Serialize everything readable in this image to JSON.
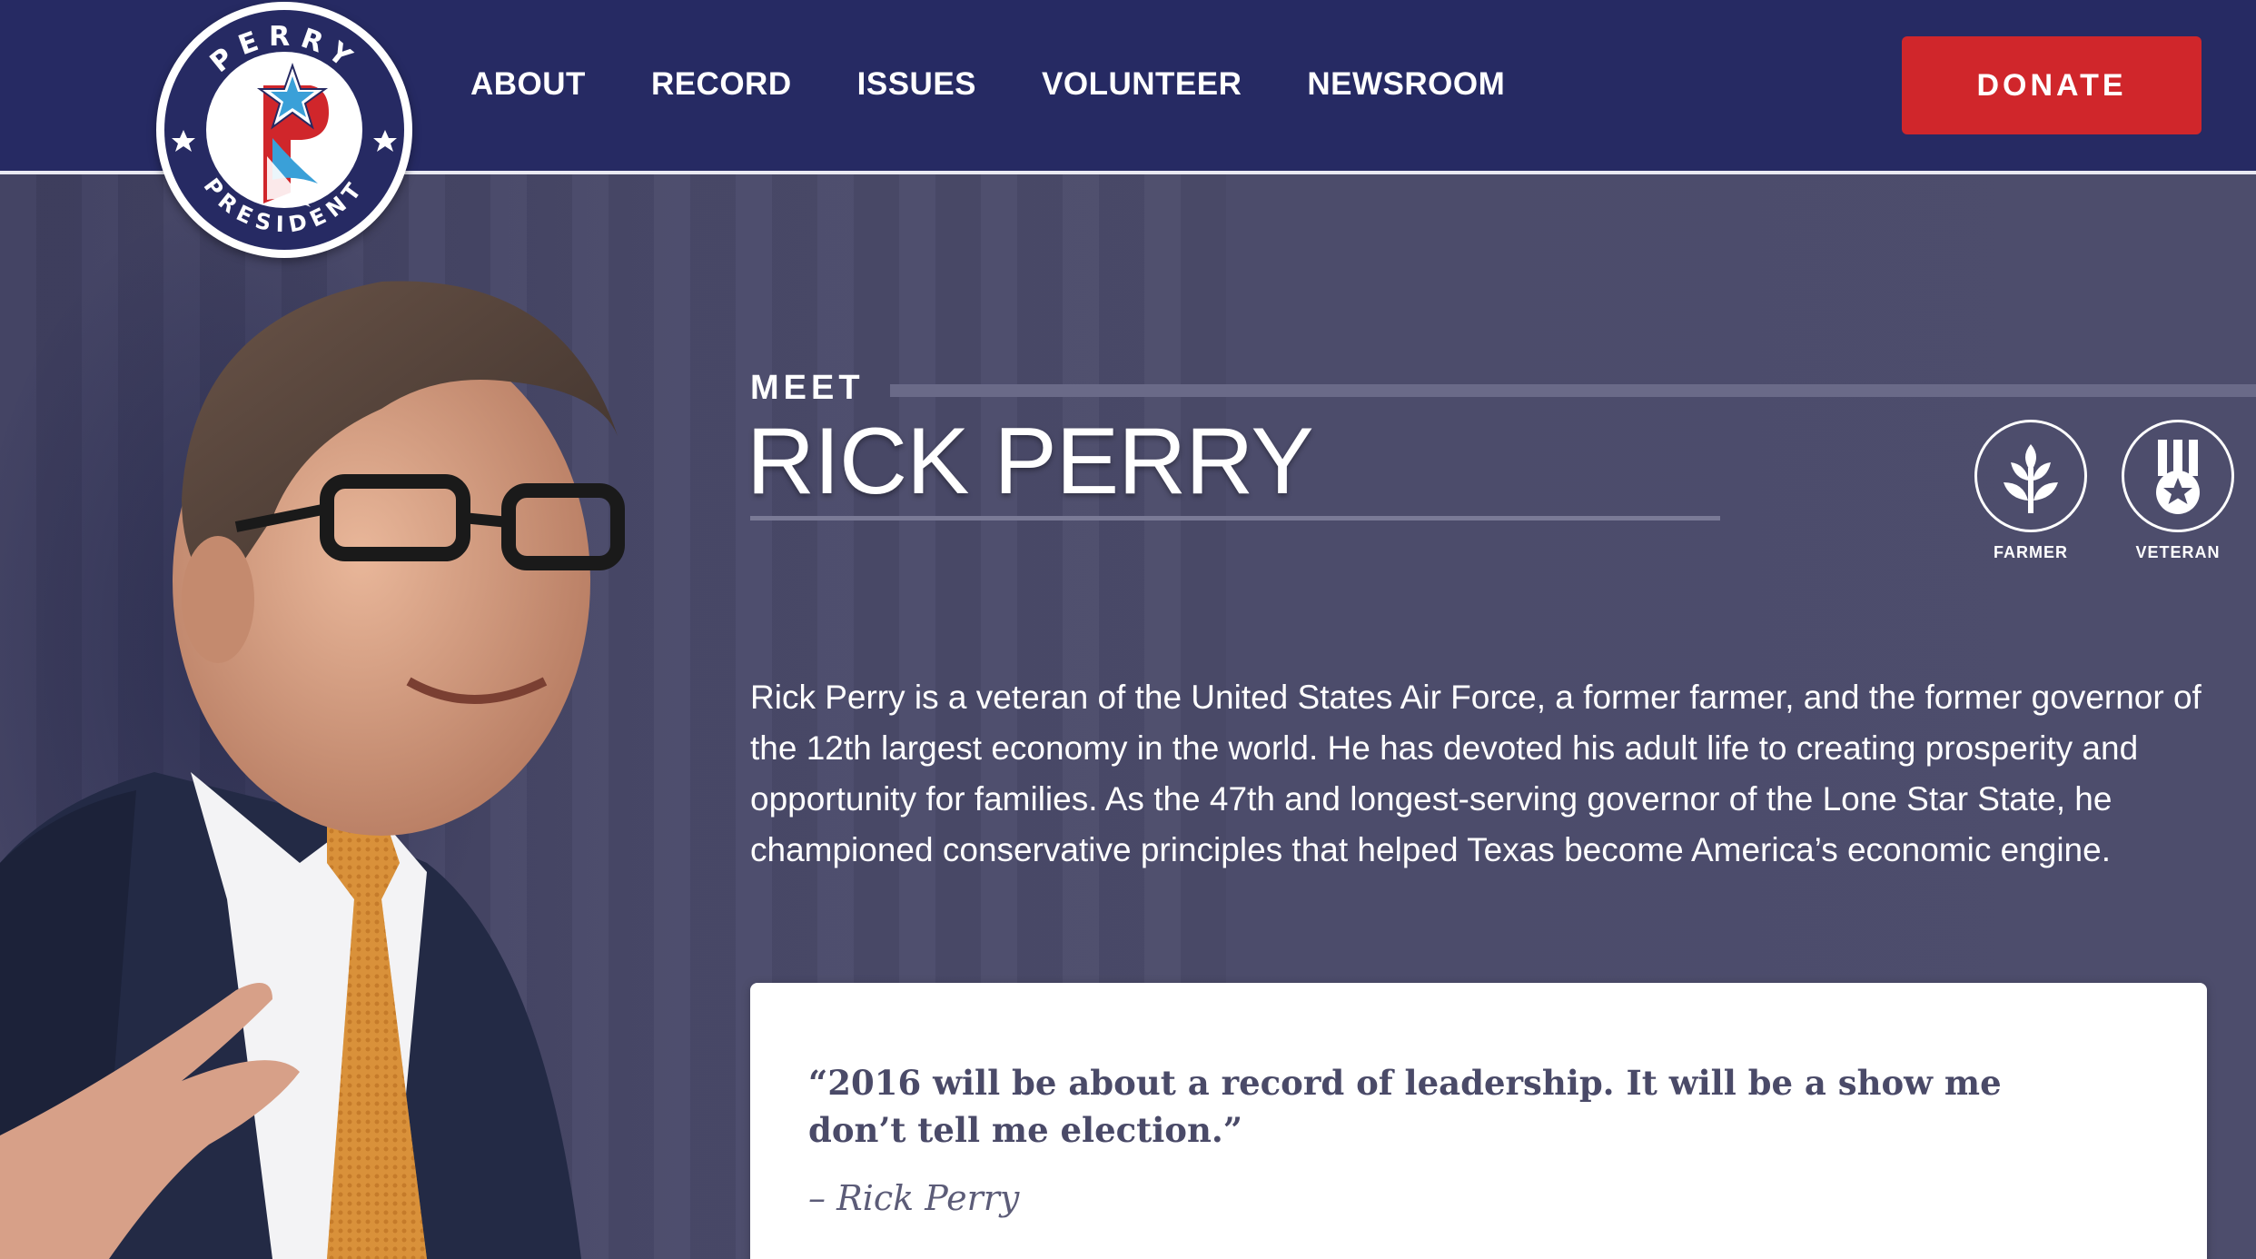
{
  "header": {
    "logo": {
      "top_text": "PERRY",
      "bottom_text": "PRESIDENT",
      "icon": "star-p-logo-icon",
      "colors": {
        "navy": "#262a63",
        "red": "#d0262b",
        "blue": "#3aa0d8"
      }
    },
    "nav": [
      {
        "label": "ABOUT"
      },
      {
        "label": "RECORD"
      },
      {
        "label": "ISSUES"
      },
      {
        "label": "VOLUNTEER"
      },
      {
        "label": "NEWSROOM"
      }
    ],
    "donate_label": "DONATE",
    "background": "#262a63"
  },
  "hero": {
    "meet_label": "MEET",
    "name": "RICK PERRY",
    "badges": [
      {
        "label": "FARMER",
        "icon": "wheat-sprout-icon"
      },
      {
        "label": "VETERAN",
        "icon": "medal-star-icon"
      }
    ],
    "bio": "Rick Perry is a veteran of the United States Air Force, a former farmer, and the former governor of the 12th largest economy in the world. He has devoted his adult life to creating prosperity and opportunity for families. As the 47th and longest-serving governor of the Lone Star State, he championed conservative principles that helped Texas become America’s economic engine.",
    "quote": {
      "text": "“2016 will be about a record of leadership. It will be a show me don’t tell me election.”",
      "attribution": "– Rick Perry"
    }
  },
  "colors": {
    "page_background": "#4d4d6c",
    "accent_red": "#d0262b"
  }
}
